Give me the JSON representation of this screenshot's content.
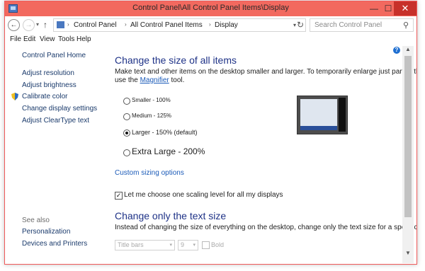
{
  "window": {
    "title": "Control Panel\\All Control Panel Items\\Display",
    "minimize_glyph": "—",
    "maximize_glyph": "☐",
    "close_glyph": "✕"
  },
  "address": {
    "crumbs": [
      "Control Panel",
      "All Control Panel Items",
      "Display"
    ],
    "separator": "›",
    "search_placeholder": "Search Control Panel"
  },
  "menu": [
    "File",
    "Edit",
    "View",
    "Tools",
    "Help"
  ],
  "sidebar": {
    "home": "Control Panel Home",
    "links": [
      "Adjust resolution",
      "Adjust brightness",
      "Calibrate color",
      "Change display settings",
      "Adjust ClearType text"
    ],
    "see_also_label": "See also",
    "see_also_links": [
      "Personalization",
      "Devices and Printers"
    ]
  },
  "main": {
    "heading1": "Change the size of all items",
    "desc_line1": "Make text and other items on the desktop smaller and larger. To temporarily enlarge just part of the screen,",
    "desc_line2_pre": "use the ",
    "desc_link": "Magnifier",
    "desc_line2_post": " tool.",
    "options": [
      {
        "label": "Smaller - 100%",
        "checked": false
      },
      {
        "label": "Medium - 125%",
        "checked": false
      },
      {
        "label": "Larger - 150% (default)",
        "checked": true
      },
      {
        "label": "Extra Large - 200%",
        "checked": false
      }
    ],
    "custom_sizing": "Custom sizing options",
    "scaling_checkbox": "Let me choose one scaling level for all my displays",
    "scaling_checked": true,
    "heading2": "Change only the text size",
    "desc2": "Instead of changing the size of everything on the desktop, change only the text size for a specific item.",
    "item_select": "Title bars",
    "size_select": "9",
    "bold_label": "Bold"
  },
  "icons": {
    "back": "back-arrow-icon",
    "forward": "forward-arrow-icon",
    "up": "up-arrow-icon",
    "refresh": "refresh-icon",
    "search": "search-icon",
    "help": "help-icon",
    "shield": "shield-icon"
  },
  "colors": {
    "titlebar": "#f2695f",
    "close_button": "#c7302a",
    "heading": "#1e3287",
    "link": "#1a3a6b"
  }
}
